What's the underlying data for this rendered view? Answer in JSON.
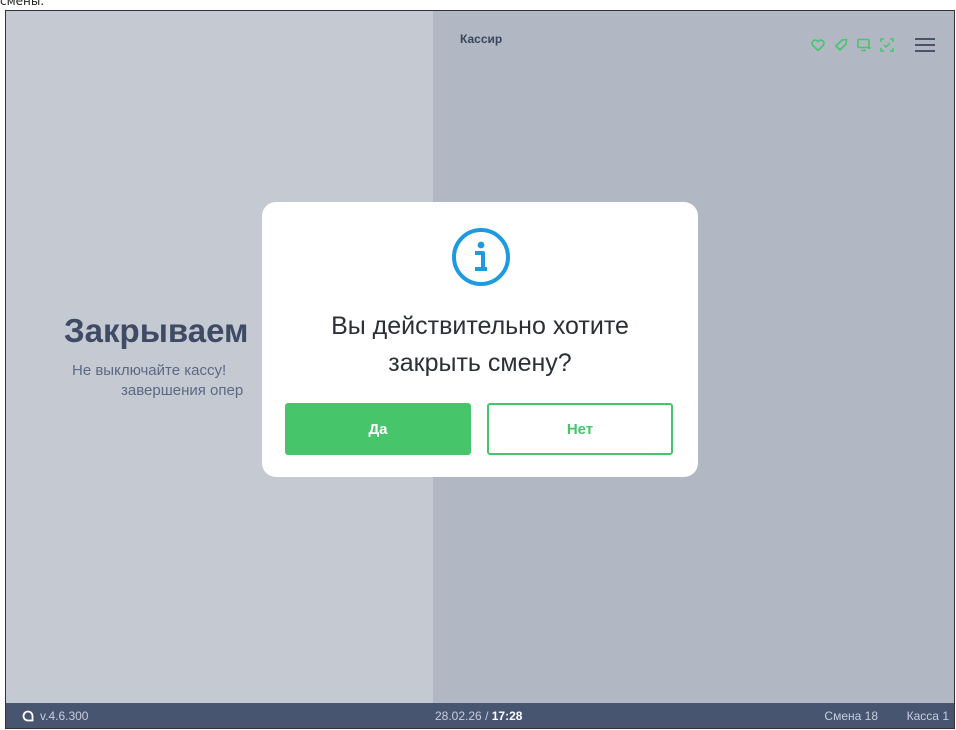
{
  "top_caption": "смены.",
  "header": {
    "title": "Кассир"
  },
  "background": {
    "title": "Закрываем",
    "subtitle_line1": "Не выключайте кассу!",
    "subtitle_line2": "завершения опер"
  },
  "modal": {
    "icon": "info-icon",
    "line1": "Вы действительно хотите",
    "line2": "закрыть смену?",
    "yes_label": "Да",
    "no_label": "Нет"
  },
  "footer": {
    "version": "v.4.6.300",
    "date": "28.02.26",
    "separator": "/",
    "time": "17:28",
    "shift": "Смена 18",
    "register": "Касса 1"
  },
  "colors": {
    "accent_green": "#47c56b",
    "info_blue": "#1e9be0",
    "footer_bg": "#475571"
  }
}
